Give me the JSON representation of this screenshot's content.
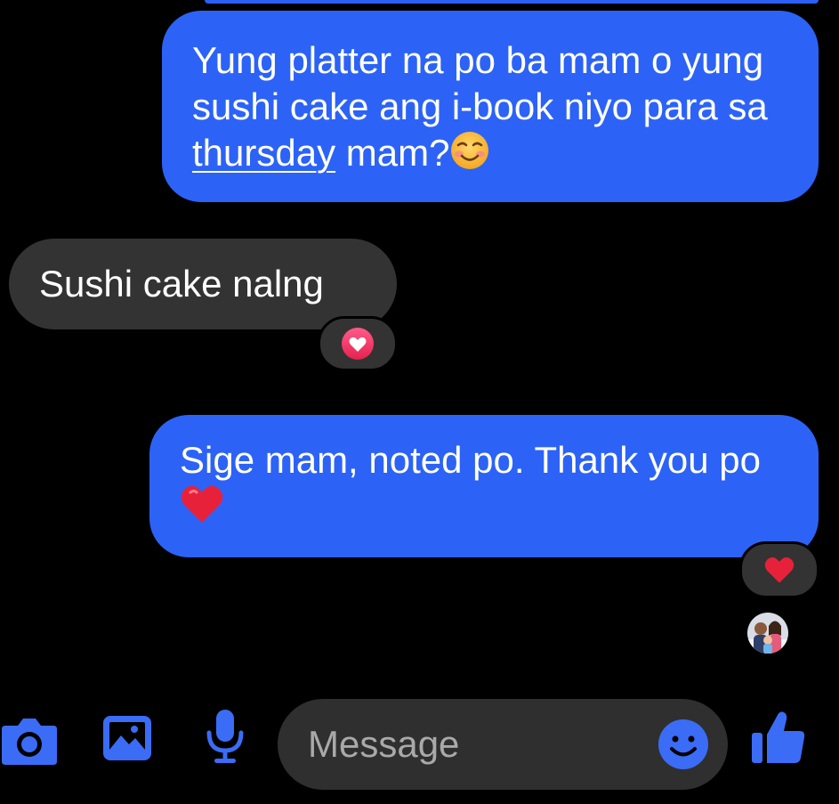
{
  "conversation": {
    "messages": [
      {
        "sender": "me",
        "text_before": "Yung platter na po ba mam o yung sushi cake ang i-book niyo para sa ",
        "link_text": "thursday",
        "text_after": " mam?",
        "emoji": "smiling-face-emoji"
      },
      {
        "sender": "them",
        "text": "Sushi cake nalng",
        "reaction": "heart-reaction"
      },
      {
        "sender": "me",
        "text": "Sige mam, noted po. Thank you po",
        "emoji": "red-heart-emoji",
        "reaction": "red-heart-reaction"
      }
    ],
    "seen_by": "contact-avatar"
  },
  "composer": {
    "placeholder": "Message",
    "icons": [
      "camera-icon",
      "gallery-icon",
      "microphone-icon",
      "emoji-icon",
      "thumbs-up-icon"
    ]
  },
  "colors": {
    "background": "#000000",
    "outgoing_bubble": "#2c63f6",
    "incoming_bubble": "#333333",
    "accent": "#3b6cf6",
    "heart": "#e8213a"
  }
}
